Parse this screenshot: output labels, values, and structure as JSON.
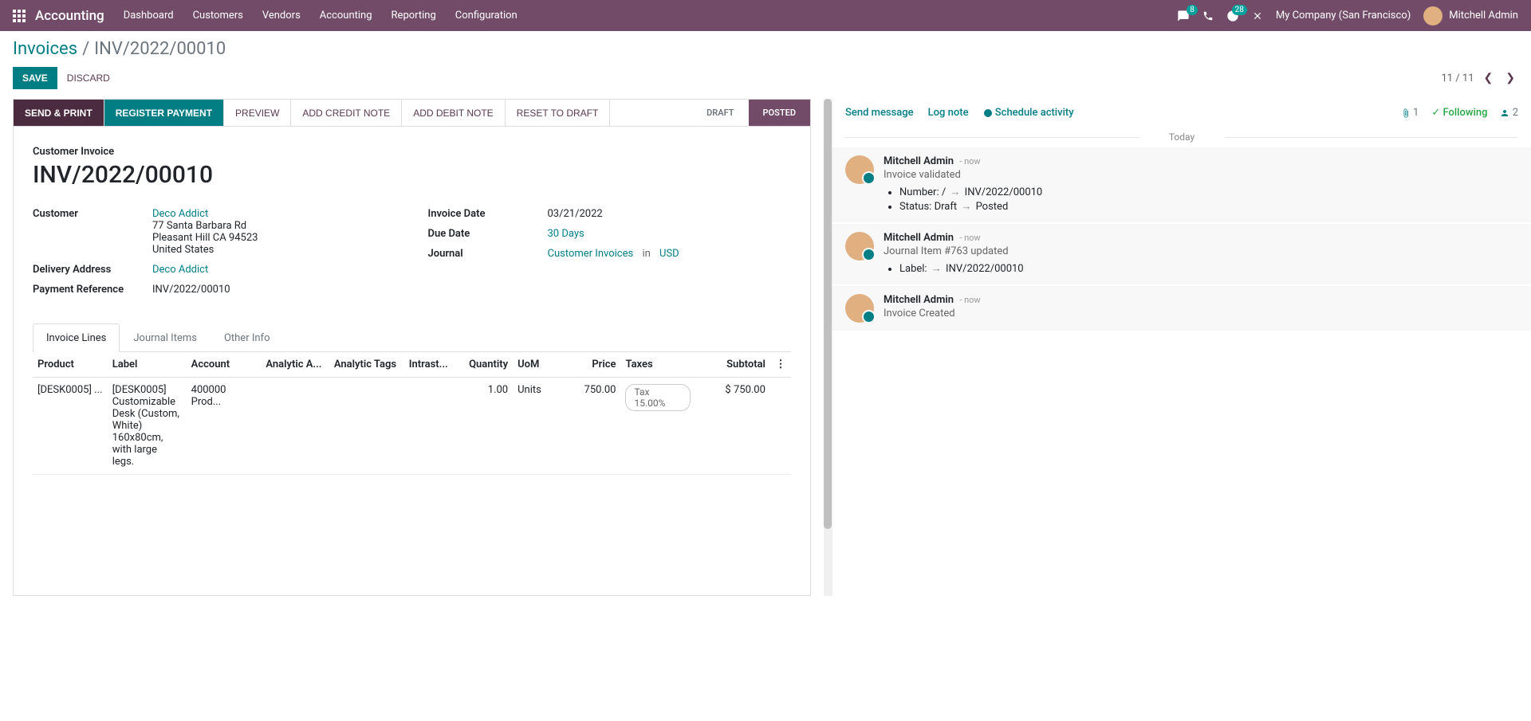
{
  "nav": {
    "app": "Accounting",
    "menus": [
      "Dashboard",
      "Customers",
      "Vendors",
      "Accounting",
      "Reporting",
      "Configuration"
    ],
    "msg_badge": "8",
    "clock_badge": "28",
    "company": "My Company (San Francisco)",
    "user": "Mitchell Admin"
  },
  "breadcrumb": {
    "parent": "Invoices",
    "current": "INV/2022/00010"
  },
  "buttons": {
    "save": "SAVE",
    "discard": "DISCARD"
  },
  "pager": {
    "text": "11 / 11"
  },
  "actions": {
    "send_print": "SEND & PRINT",
    "register_payment": "REGISTER PAYMENT",
    "preview": "PREVIEW",
    "credit": "ADD CREDIT NOTE",
    "debit": "ADD DEBIT NOTE",
    "reset": "RESET TO DRAFT"
  },
  "status": {
    "draft": "DRAFT",
    "posted": "POSTED"
  },
  "invoice": {
    "type_label": "Customer Invoice",
    "name": "INV/2022/00010",
    "customer_label": "Customer",
    "customer": "Deco Addict",
    "addr1": "77 Santa Barbara Rd",
    "addr2": "Pleasant Hill CA 94523",
    "addr3": "United States",
    "delivery_label": "Delivery Address",
    "delivery": "Deco Addict",
    "payref_label": "Payment Reference",
    "payref": "INV/2022/00010",
    "invdate_label": "Invoice Date",
    "invdate": "03/21/2022",
    "duedate_label": "Due Date",
    "duedate": "30 Days",
    "journal_label": "Journal",
    "journal": "Customer Invoices",
    "in": "in",
    "currency": "USD"
  },
  "tabs": {
    "lines": "Invoice Lines",
    "items": "Journal Items",
    "other": "Other Info"
  },
  "table": {
    "headers": {
      "product": "Product",
      "label": "Label",
      "account": "Account",
      "analytic_acc": "Analytic A...",
      "analytic_tags": "Analytic Tags",
      "intrastat": "Intrast...",
      "qty": "Quantity",
      "uom": "UoM",
      "price": "Price",
      "taxes": "Taxes",
      "subtotal": "Subtotal"
    },
    "row": {
      "product": "[DESK0005] ...",
      "label": "[DESK0005] Customizable Desk (Custom, White) 160x80cm, with large legs.",
      "account": "400000 Prod...",
      "qty": "1.00",
      "uom": "Units",
      "price": "750.00",
      "tax": "Tax 15.00%",
      "subtotal": "$ 750.00"
    }
  },
  "chatter": {
    "send": "Send message",
    "log": "Log note",
    "schedule": "Schedule activity",
    "attach_count": "1",
    "following": "Following",
    "followers": "2",
    "today": "Today",
    "m1": {
      "author": "Mitchell Admin",
      "time": "- now",
      "text": "Invoice validated",
      "li1_label": "Number:",
      "li1_before": "/",
      "li1_after": "INV/2022/00010",
      "li2_label": "Status:",
      "li2_before": "Draft",
      "li2_after": "Posted"
    },
    "m2": {
      "author": "Mitchell Admin",
      "time": "- now",
      "text": "Journal Item #763 updated",
      "li1_label": "Label:",
      "li1_after": "INV/2022/00010"
    },
    "m3": {
      "author": "Mitchell Admin",
      "time": "- now",
      "text": "Invoice Created"
    }
  }
}
